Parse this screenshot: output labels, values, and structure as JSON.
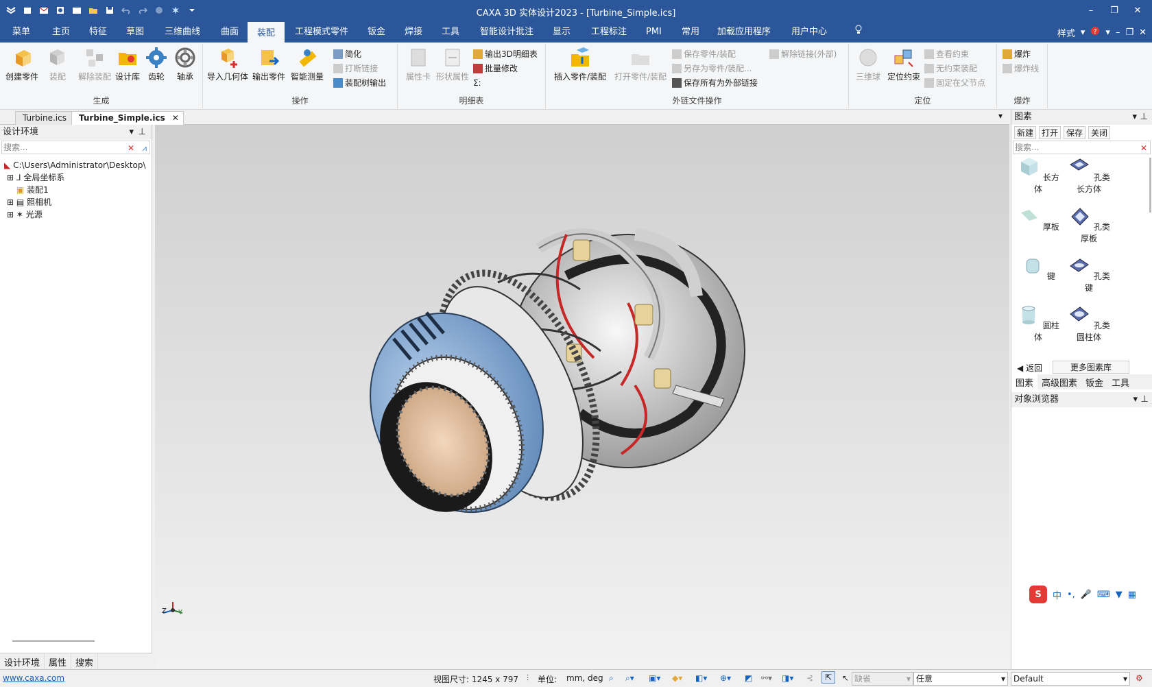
{
  "window": {
    "title": "CAXA 3D 实体设计2023 - [Turbine_Simple.ics]"
  },
  "menu": {
    "tabs": [
      "菜单",
      "主页",
      "特征",
      "草图",
      "三维曲线",
      "曲面",
      "装配",
      "工程模式零件",
      "钣金",
      "焊接",
      "工具",
      "智能设计批注",
      "显示",
      "工程标注",
      "PMI",
      "常用",
      "加载应用程序",
      "用户中心"
    ],
    "active": "装配",
    "style_label": "样式"
  },
  "ribbon": {
    "gen": {
      "label": "生成",
      "b1": "创建零件",
      "b2": "装配",
      "b3": "解除装配",
      "b4": "设计库",
      "b5": "齿轮",
      "b6": "轴承"
    },
    "ops": {
      "label": "操作",
      "b1": "导入几何体",
      "b2": "输出零件",
      "b3": "智能测量",
      "s1": "简化",
      "s2": "打断链接",
      "s3": "装配树输出"
    },
    "bom": {
      "label": "明细表",
      "b1": "属性卡",
      "b2": "形状属性",
      "s1": "输出3D明细表",
      "s2": "批量修改",
      "s3": "Σ:"
    },
    "ext": {
      "label": "外链文件操作",
      "b1": "插入零件/装配",
      "b2": "打开零件/装配",
      "s1": "保存零件/装配",
      "s2": "另存为零件/装配...",
      "s3": "保存所有为外部链接",
      "s4": "解除链接(外部)"
    },
    "pos": {
      "label": "定位",
      "b1": "三维球",
      "b2": "定位约束",
      "s1": "查看约束",
      "s2": "无约束装配",
      "s3": "固定在父节点"
    },
    "exp": {
      "label": "爆炸",
      "s1": "爆炸",
      "s2": "爆炸线"
    }
  },
  "doc_tabs": [
    "Turbine.ics",
    "Turbine_Simple.ics"
  ],
  "left_panel": {
    "title": "设计环境",
    "search_placeholder": "搜索...",
    "tree": [
      "C:\\Users\\Administrator\\Desktop\\",
      "全局坐标系",
      "装配1",
      "照相机",
      "光源"
    ],
    "bottom_tabs": [
      "设计环境",
      "属性",
      "搜索"
    ]
  },
  "right_panel": {
    "title": "图素",
    "tools": [
      "新建",
      "打开",
      "保存",
      "关闭"
    ],
    "search_placeholder": "搜索...",
    "items": [
      "长方体",
      "孔类长方体",
      "厚板",
      "孔类厚板",
      "键",
      "孔类键",
      "圆柱体",
      "孔类圆柱体"
    ],
    "back": "返回",
    "more": "更多图素库",
    "tabs": [
      "图素",
      "高级图素",
      "钣金",
      "工具"
    ],
    "object_browser": "对象浏览器"
  },
  "status": {
    "link": "www.caxa.com",
    "view_size_label": "视图尺寸: 1245 x   797",
    "unit_label": "单位:",
    "unit_value": "mm, deg",
    "filter1": "缺省",
    "filter2": "任意",
    "style": "Default"
  },
  "axis": {
    "x": "X",
    "y": "Y",
    "z": "Z"
  },
  "colors": {
    "titlebar": "#2b579a",
    "accent": "#2b579a"
  }
}
